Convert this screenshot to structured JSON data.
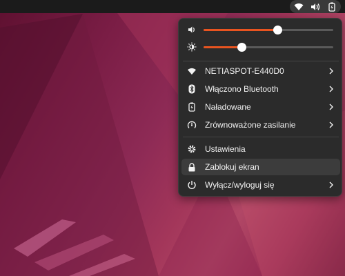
{
  "colors": {
    "accent": "#e95420",
    "menu_bg": "#2b2b2b",
    "text": "#f2f2f2"
  },
  "tray": {
    "icons": [
      "wifi-icon",
      "volume-icon",
      "battery-icon"
    ]
  },
  "sliders": {
    "volume": {
      "icon": "volume-icon",
      "level": 0.57
    },
    "brightness": {
      "icon": "brightness-icon",
      "level": 0.29
    }
  },
  "menu": {
    "network": {
      "label": "NETIASPOT-E440D0",
      "icon": "wifi-icon"
    },
    "bluetooth": {
      "label": "Włączono Bluetooth",
      "icon": "bluetooth-icon"
    },
    "battery": {
      "label": "Naładowane",
      "icon": "battery-icon"
    },
    "power_mode": {
      "label": "Zrównoważone zasilanie",
      "icon": "power-mode-icon"
    },
    "settings": {
      "label": "Ustawienia",
      "icon": "settings-icon"
    },
    "lock": {
      "label": "Zablokuj ekran",
      "icon": "lock-icon"
    },
    "power_off": {
      "label": "Wyłącz/wyloguj się",
      "icon": "power-icon"
    }
  }
}
